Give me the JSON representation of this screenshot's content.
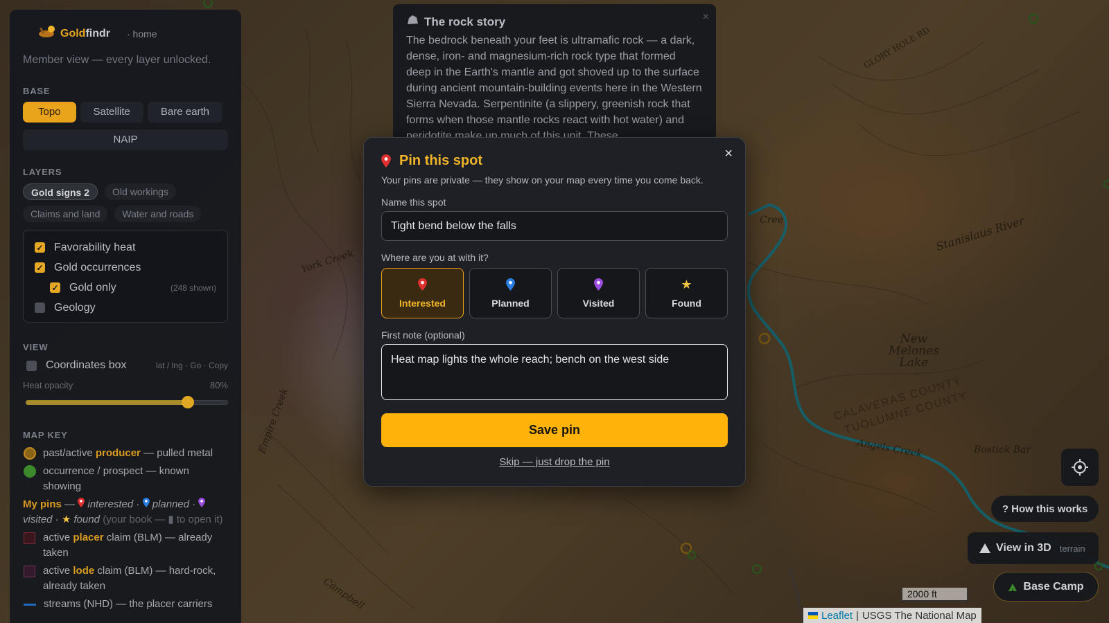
{
  "map": {
    "labels": {
      "stanislaus": "Stanislaus River",
      "new_melones": "New\nMelones\nLake",
      "calaveras": "CALAVERAS COUNTY",
      "tuolumne": "TUOLUMNE COUNTY",
      "angels_creek": "Angels Creek",
      "bostick_bar": "Bostick Bar",
      "york_creek": "York Creek",
      "creek_right": "Cree",
      "glory_hole": "GLORY HOLE RD",
      "campbell": "Campbell",
      "empire_creek": "Empire Creek"
    }
  },
  "sidebar": {
    "brand": {
      "name_gold": "Gold",
      "name_rest": "findr",
      "home": "· home"
    },
    "member_view": "Member view — every layer unlocked.",
    "base": {
      "title": "BASE",
      "options": [
        "Topo",
        "Satellite",
        "Bare earth",
        "NAIP"
      ],
      "selected": "Topo"
    },
    "layers": {
      "title": "LAYERS",
      "tabs": [
        "Gold signs 2",
        "Old workings",
        "Claims and land",
        "Water and roads"
      ],
      "items": [
        {
          "label": "Favorability heat",
          "checked": true
        },
        {
          "label": "Gold occurrences",
          "checked": true
        },
        {
          "label": "Gold only",
          "checked": true,
          "note": "(248 shown)"
        },
        {
          "label": "Geology",
          "checked": false
        }
      ]
    },
    "view": {
      "title": "VIEW",
      "coords_label": "Coordinates box",
      "coords_hint": "lat / lng · Go · Copy",
      "opacity_label": "Heat opacity",
      "opacity_value": "80%",
      "opacity_fraction": 0.8
    },
    "map_key": {
      "title": "MAP KEY",
      "producer_pre": "past/active ",
      "producer_bold": "producer",
      "producer_post": " — pulled metal",
      "occurrence": "occurrence / prospect — known showing",
      "pins_bold": "My pins",
      "pins_dash": " — ",
      "pins_interested": " interested · ",
      "pins_planned": " planned · ",
      "pins_visited": "visited · ",
      "pins_found": " found",
      "pins_book_a": " (your book — ",
      "pins_book_b": " to open it)",
      "placer_pre": "active ",
      "placer_bold": "placer",
      "placer_post": " claim (BLM) — already taken",
      "lode_pre": "active ",
      "lode_bold": "lode",
      "lode_post": " claim (BLM) — hard-rock, already taken",
      "streams": "streams (NHD) — the placer carriers"
    }
  },
  "rock_story": {
    "title": "The rock story",
    "body": "The bedrock beneath your feet is ultramafic rock — a dark, dense, iron- and magnesium-rich rock type that formed deep in the Earth's mantle and got shoved up to the surface during ancient mountain-building events here in the Western Sierra Nevada. Serpentinite (a slippery, greenish rock that forms when those mantle rocks react with hot water) and peridotite make up much of this unit. These",
    "close": "×"
  },
  "modal": {
    "title": "Pin this spot",
    "subtitle": "Your pins are private — they show on your map every time you come back.",
    "name_label": "Name this spot",
    "name_value": "Tight bend below the falls",
    "status_label": "Where are you at with it?",
    "statuses": [
      {
        "label": "Interested",
        "color": "#e03131"
      },
      {
        "label": "Planned",
        "color": "#2b7de0"
      },
      {
        "label": "Visited",
        "color": "#9b4de0"
      },
      {
        "label": "Found",
        "color": "#f5c542"
      }
    ],
    "selected_status": "Interested",
    "note_label": "First note (optional)",
    "note_value": "Heat map lights the whole reach; bench on the west side",
    "save_label": "Save pin",
    "skip_label": "Skip — just drop the pin",
    "close": "×"
  },
  "controls": {
    "how_label": "? How this works",
    "view3d_label": "View in 3D",
    "view3d_sub": "terrain",
    "basecamp_label": "Base Camp",
    "scale_label": "2000 ft",
    "attribution_leaflet": "Leaflet",
    "attribution_sep": "|",
    "attribution_source": "USGS The National Map"
  },
  "colors": {
    "accent": "#e9a41c",
    "producer_dot": "#c08a1c",
    "occurrence_dot": "#3d8a2c",
    "stream": "#1a9fb5"
  }
}
